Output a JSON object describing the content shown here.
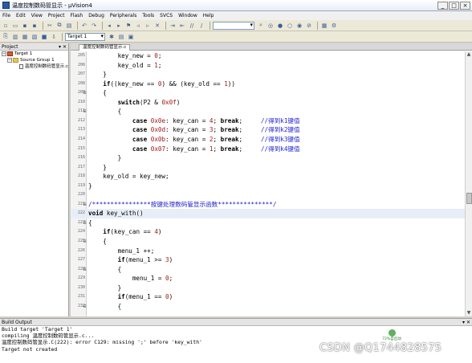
{
  "app": {
    "title": "温度控制数码管显示 - µVision4"
  },
  "menu": [
    "File",
    "Edit",
    "View",
    "Project",
    "Flash",
    "Debug",
    "Peripherals",
    "Tools",
    "SVCS",
    "Window",
    "Help"
  ],
  "toolbar": {
    "target_select": "Target 1"
  },
  "project": {
    "panel_title": "Project",
    "tree": [
      {
        "label": "Target 1",
        "kind": "target",
        "depth": 0
      },
      {
        "label": "Source Group 1",
        "kind": "folder",
        "depth": 1
      },
      {
        "label": "温度控制数码管显示.c",
        "kind": "file",
        "depth": 2
      }
    ]
  },
  "editor": {
    "tab_label": "温度控制数码管显示.c",
    "lines": [
      {
        "num": "205",
        "text": "        key_new = 0;"
      },
      {
        "num": "206",
        "text": "        key_old = 1;"
      },
      {
        "num": "207",
        "text": "    }"
      },
      {
        "num": "208",
        "text": "    if((key_new == 0) && (key_old == 1))"
      },
      {
        "num": "209",
        "text": "    {",
        "fold": "⊟"
      },
      {
        "num": "210",
        "text": "        switch(P2 & 0x0f)"
      },
      {
        "num": "211",
        "text": "        {",
        "fold": "⊟"
      },
      {
        "num": "212",
        "text": "            case 0x0e: key_can = 4; break;     //得到k1键值"
      },
      {
        "num": "213",
        "text": "            case 0x0d: key_can = 3; break;     //得到k2键值"
      },
      {
        "num": "214",
        "text": "            case 0x0b: key_can = 2; break;     //得到k3键值"
      },
      {
        "num": "215",
        "text": "            case 0x07: key_can = 1; break;     //得到k4键值"
      },
      {
        "num": "216",
        "text": "        }"
      },
      {
        "num": "217",
        "text": "    }"
      },
      {
        "num": "218",
        "text": "    key_old = key_new;"
      },
      {
        "num": "219",
        "text": "}"
      },
      {
        "num": "220",
        "text": ""
      },
      {
        "num": "221",
        "text": "/****************按键处理数码管显示函数***************/",
        "fold": "⊟"
      },
      {
        "num": "222",
        "text": "void key_with()",
        "hl": true
      },
      {
        "num": "223",
        "text": "{",
        "fold": "⊟"
      },
      {
        "num": "224",
        "text": "    if(key_can == 4)"
      },
      {
        "num": "225",
        "text": "    {",
        "fold": "⊟"
      },
      {
        "num": "226",
        "text": "        menu_1 ++;"
      },
      {
        "num": "227",
        "text": "        if(menu_1 >= 3)"
      },
      {
        "num": "228",
        "text": "        {",
        "fold": "⊟"
      },
      {
        "num": "229",
        "text": "            menu_1 = 0;"
      },
      {
        "num": "230",
        "text": "        }"
      },
      {
        "num": "231",
        "text": "        if(menu_1 == 0)"
      },
      {
        "num": "232",
        "text": "        {",
        "fold": "⊟"
      }
    ]
  },
  "build": {
    "panel_title": "Build Output",
    "lines": [
      "Build target 'Target 1'",
      "compiling 温度控制数码管显示.c...",
      "温度控制数码管显示.C(222): error C129: missing ';' before 'key_with'",
      "Target not created"
    ]
  },
  "badge": {
    "line1": "72%自启动"
  },
  "watermark": "CSDN @Q1744828575"
}
